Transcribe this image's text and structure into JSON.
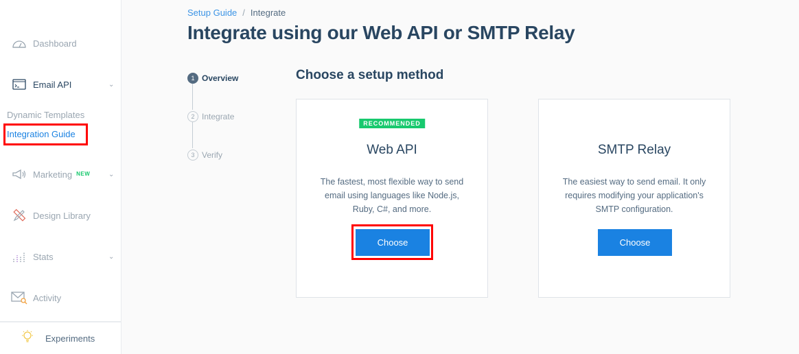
{
  "sidebar": {
    "items": [
      {
        "label": "Dashboard",
        "icon": "gauge-icon"
      },
      {
        "label": "Email API",
        "icon": "terminal-window-icon"
      },
      {
        "label": "Marketing",
        "icon": "megaphone-icon",
        "badge": "NEW"
      },
      {
        "label": "Design Library",
        "icon": "pencil-ruler-icon"
      },
      {
        "label": "Stats",
        "icon": "bar-chart-icon"
      },
      {
        "label": "Activity",
        "icon": "envelope-search-icon"
      }
    ],
    "subitems": [
      {
        "label": "Dynamic Templates"
      },
      {
        "label": "Integration Guide"
      }
    ],
    "footer": {
      "label": "Experiments",
      "icon": "lightbulb-icon"
    }
  },
  "breadcrumb": {
    "parent": "Setup Guide",
    "separator": "/",
    "current": "Integrate"
  },
  "page_title": "Integrate using our Web API or SMTP Relay",
  "stepper": [
    {
      "num": "1",
      "label": "Overview"
    },
    {
      "num": "2",
      "label": "Integrate"
    },
    {
      "num": "3",
      "label": "Verify"
    }
  ],
  "section_title": "Choose a setup method",
  "cards": [
    {
      "badge": "RECOMMENDED",
      "title": "Web API",
      "description": "The fastest, most flexible way to send email using languages like Node.js, Ruby, C#, and more.",
      "button": "Choose"
    },
    {
      "title": "SMTP Relay",
      "description": "The easiest way to send email. It only requires modifying your application's SMTP configuration.",
      "button": "Choose"
    }
  ],
  "colors": {
    "primary": "#1a82e2",
    "text": "#294661",
    "muted": "#9aa6b1",
    "recommended": "#18c96e",
    "highlight": "#ff0000"
  }
}
